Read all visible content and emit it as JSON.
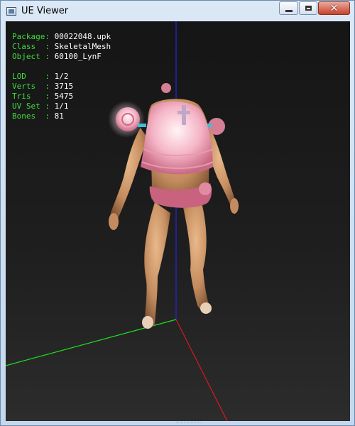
{
  "window": {
    "title": "UE Viewer",
    "controls": {
      "minimize_icon": "minimize-icon",
      "maximize_icon": "maximize-icon",
      "close_glyph": "✕"
    }
  },
  "info": {
    "package": {
      "label": "Package:",
      "value": "00022048.upk"
    },
    "class": {
      "label": "Class  :",
      "value": "SkeletalMesh"
    },
    "object": {
      "label": "Object :",
      "value": "60100_LynF"
    },
    "lod": {
      "label": "LOD    :",
      "value": "1/2"
    },
    "verts": {
      "label": "Verts  :",
      "value": "3715"
    },
    "tris": {
      "label": "Tris   :",
      "value": "5475"
    },
    "uvset": {
      "label": "UV Set :",
      "value": "1/1"
    },
    "bones": {
      "label": "Bones  :",
      "value": "81"
    }
  },
  "colors": {
    "label_green": "#3fdd3f",
    "axis_x": "#d81a1a",
    "axis_y": "#1fe01f",
    "axis_z": "#2323e8",
    "viewport_bg": "#1c1c1c"
  }
}
